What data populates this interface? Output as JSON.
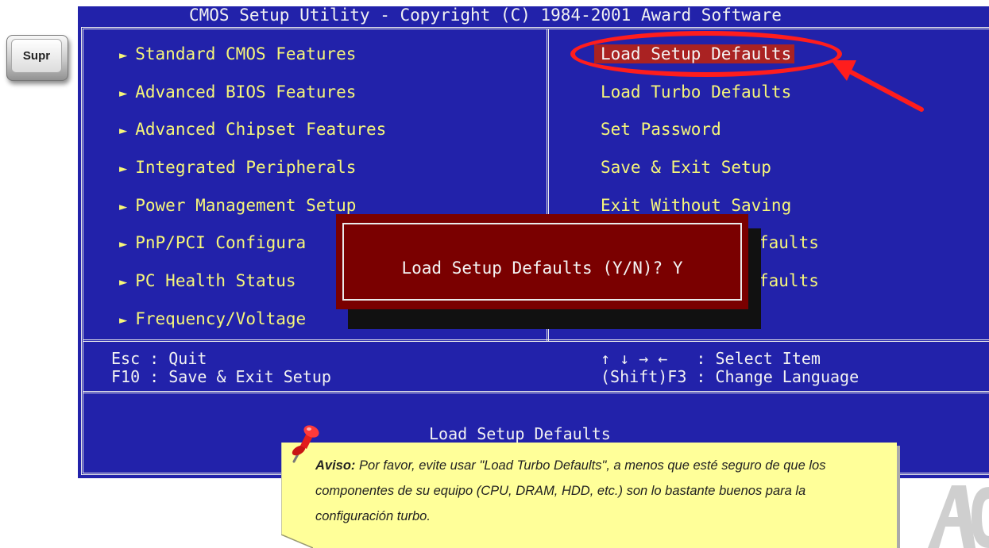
{
  "key": {
    "label": "Supr"
  },
  "bios": {
    "title": "CMOS Setup Utility - Copyright (C) 1984-2001 Award Software",
    "left_menu": [
      "Standard CMOS Features",
      "Advanced BIOS Features",
      "Advanced Chipset Features",
      "Integrated Peripherals",
      "Power Management Setup",
      "PnP/PCI Configura",
      "PC Health Status",
      "Frequency/Voltage"
    ],
    "right_menu": [
      "Load Setup Defaults",
      "Load Turbo Defaults",
      "Set Password",
      "Save & Exit Setup",
      "Exit Without Saving",
      "faults",
      "faults"
    ],
    "footer": {
      "esc": "Esc : Quit",
      "f10": "F10 : Save & Exit Setup",
      "arrows": "↑ ↓ → ←   : Select Item",
      "shift_f3": "(Shift)F3 : Change Language"
    },
    "status_line": "Load Setup Defaults",
    "dialog": {
      "text": "Load Setup Defaults (Y/N)? Y"
    }
  },
  "note": {
    "label": "Aviso:",
    "text": " Por favor, evite usar \"Load Turbo Defaults\", a menos que esté seguro de que los componentes de su equipo (CPU, DRAM, HDD, etc.) son lo bastante buenos para la configuración turbo."
  },
  "colors": {
    "bios_bg": "#2222aa",
    "menu_text": "#f6f67a",
    "highlight": "#aa2222",
    "dialog_bg": "#7a0000",
    "annotation": "#ff1d1d",
    "note_bg": "#ffff99"
  }
}
